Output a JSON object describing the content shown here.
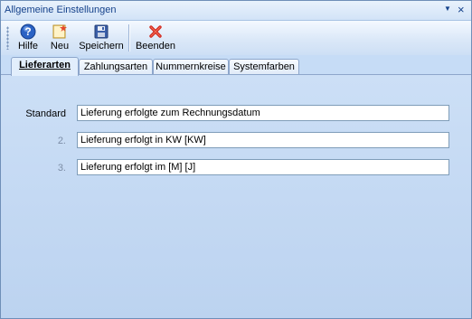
{
  "window": {
    "title": "Allgemeine Einstellungen",
    "close_icon": "close-icon",
    "caret_icon": "dropdown-caret-icon"
  },
  "toolbar": {
    "buttons": [
      {
        "label": "Hilfe",
        "icon": "help-icon"
      },
      {
        "label": "Neu",
        "icon": "new-icon"
      },
      {
        "label": "Speichern",
        "icon": "save-icon"
      },
      {
        "label": "Beenden",
        "icon": "exit-icon"
      }
    ]
  },
  "tabs": [
    {
      "label": "Lieferarten",
      "active": true
    },
    {
      "label": "Zahlungsarten",
      "active": false
    },
    {
      "label": "Nummernkreise",
      "active": false
    },
    {
      "label": "Systemfarben",
      "active": false
    }
  ],
  "rows": [
    {
      "label": "Standard",
      "value": "Lieferung erfolgte zum Rechnungsdatum"
    },
    {
      "label": "2.",
      "value": "Lieferung erfolgt in KW [KW]"
    },
    {
      "label": "3.",
      "value": "Lieferung erfolgt im [M] [J]"
    }
  ],
  "colors": {
    "window_bg": "#c6dcf6",
    "title_text": "#15428b",
    "close_red": "#d0261c",
    "help_blue": "#2b62c4"
  }
}
